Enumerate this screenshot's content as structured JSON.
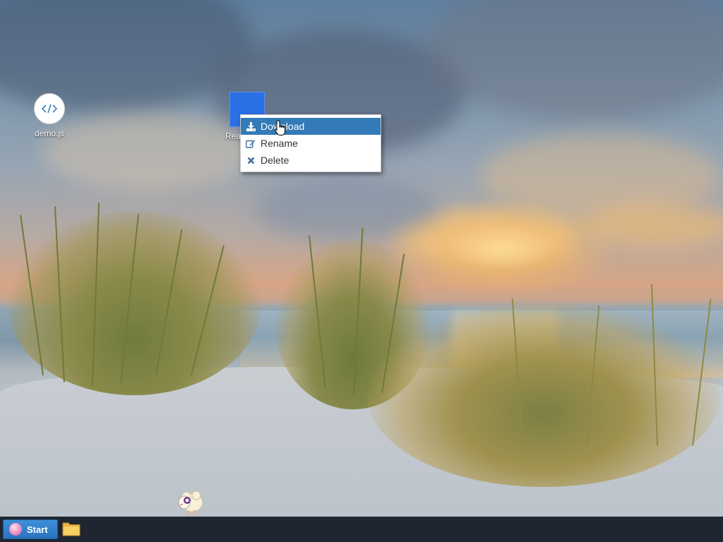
{
  "desktop": {
    "icons": [
      {
        "label": "demo.js",
        "icon": "code-icon"
      },
      {
        "label": "Rea",
        "icon": "blue-file-icon"
      }
    ]
  },
  "context_menu": {
    "items": [
      {
        "label": "Download",
        "icon": "download-icon",
        "active": true
      },
      {
        "label": "Rename",
        "icon": "edit-icon",
        "active": false
      },
      {
        "label": "Delete",
        "icon": "close-icon",
        "active": false
      }
    ]
  },
  "taskbar": {
    "start_label": "Start",
    "apps": [
      {
        "icon": "folder-icon"
      }
    ]
  },
  "colors": {
    "menu_highlight": "#337ab7",
    "taskbar": "#1f2631",
    "start_button": "#2a73bd",
    "file_icon": "#2b6fe5"
  }
}
